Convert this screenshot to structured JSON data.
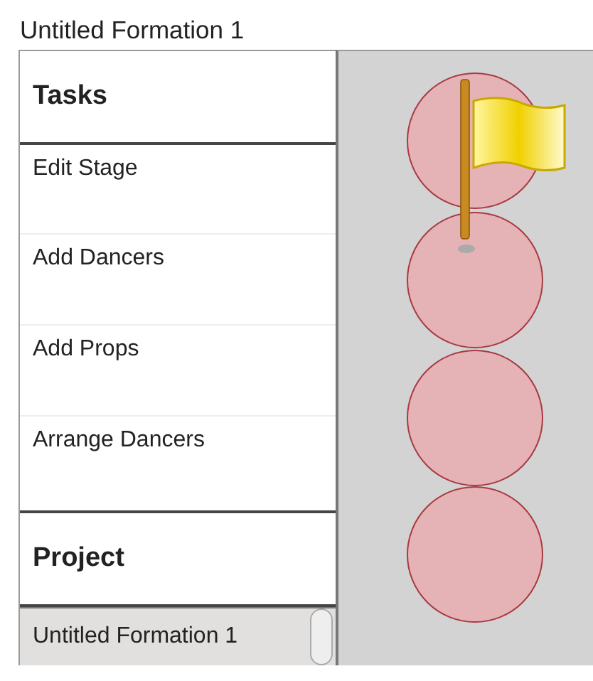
{
  "title": "Untitled Formation 1",
  "tasks": {
    "heading": "Tasks",
    "items": [
      {
        "label": "Edit Stage"
      },
      {
        "label": "Add Dancers"
      },
      {
        "label": "Add Props"
      },
      {
        "label": "Arrange Dancers"
      }
    ]
  },
  "project": {
    "heading": "Project",
    "items": [
      {
        "label": "Untitled Formation 1",
        "selected": true
      }
    ]
  }
}
